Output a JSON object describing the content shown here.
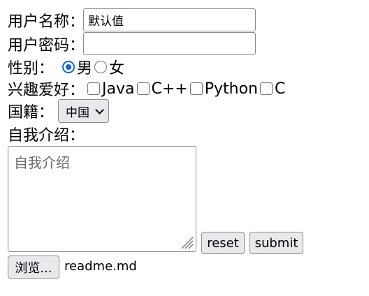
{
  "form": {
    "username_label": "用户名称：",
    "username_value": "默认值",
    "password_label": "用户密码：",
    "password_value": "",
    "gender_label": "性别：",
    "gender_options": [
      {
        "label": "男",
        "checked": true
      },
      {
        "label": "女",
        "checked": false
      }
    ],
    "hobby_label": "兴趣爱好：",
    "hobby_options": [
      "Java",
      "C++",
      "Python",
      "C"
    ],
    "nationality_label": "国籍：",
    "nationality_selected": "中国",
    "intro_label": "自我介绍：",
    "intro_placeholder": "自我介绍",
    "reset_label": "reset",
    "submit_label": "submit",
    "browse_label": "浏览...",
    "file_name": "readme.md"
  },
  "colors": {
    "radio_accent": "#1565d8",
    "button_bg": "#e9e9ed",
    "border": "#8d8d8d"
  }
}
